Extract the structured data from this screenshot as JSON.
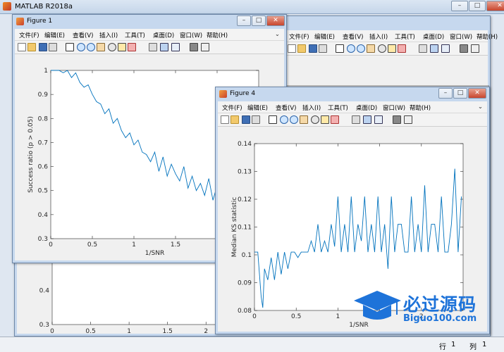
{
  "app": {
    "title": "MATLAB R2018a"
  },
  "statusbar": {
    "row_label": "行",
    "row_value": "1",
    "col_label": "列",
    "col_value": "1"
  },
  "menus": [
    "文件(F)",
    "编辑(E)",
    "查看(V)",
    "插入(I)",
    "工具(T)",
    "桌面(D)",
    "窗口(W)",
    "帮助(H)"
  ],
  "figure1": {
    "title": "Figure 1"
  },
  "figure4": {
    "title": "Figure 4"
  },
  "watermark": {
    "text": "必过源码",
    "subtext": "Biguo100.com"
  },
  "colors": {
    "line": "#0072bd",
    "window_chrome": "#c6d8ee",
    "figure_bg": "#f0f0f0"
  },
  "chart_data": [
    {
      "id": "figure1-axes",
      "type": "line",
      "xlabel": "1/SNR",
      "ylabel": "Success ratio (p > 0.05)",
      "xlim": [
        0,
        2.5
      ],
      "ylim": [
        0.3,
        1.0
      ],
      "xticks": [
        "0",
        "0.5",
        "1",
        "1.5",
        "2"
      ],
      "yticks": [
        "0.3",
        "0.4",
        "0.5",
        "0.6",
        "0.7",
        "0.8",
        "0.9",
        "1"
      ],
      "series": [
        {
          "x": [
            0.0,
            0.05,
            0.1,
            0.15,
            0.2,
            0.25,
            0.3,
            0.35,
            0.4,
            0.45,
            0.5,
            0.55,
            0.6,
            0.65,
            0.7,
            0.75,
            0.8,
            0.85,
            0.9,
            0.95,
            1.0,
            1.05,
            1.1,
            1.15,
            1.2,
            1.25,
            1.3,
            1.35,
            1.4,
            1.45,
            1.5,
            1.55,
            1.6,
            1.65,
            1.7,
            1.75,
            1.8,
            1.85,
            1.9,
            1.95,
            2.0,
            2.05,
            2.1,
            2.15,
            2.2,
            2.25,
            2.3,
            2.35,
            2.4
          ],
          "y": [
            1.0,
            1.0,
            1.0,
            0.99,
            1.0,
            0.97,
            0.99,
            0.95,
            0.93,
            0.94,
            0.9,
            0.87,
            0.86,
            0.82,
            0.84,
            0.78,
            0.8,
            0.75,
            0.72,
            0.74,
            0.69,
            0.71,
            0.66,
            0.65,
            0.62,
            0.66,
            0.58,
            0.64,
            0.56,
            0.61,
            0.57,
            0.54,
            0.6,
            0.51,
            0.56,
            0.5,
            0.53,
            0.48,
            0.55,
            0.46,
            0.52,
            0.44,
            0.5,
            0.42,
            0.47,
            0.4,
            0.51,
            0.45,
            0.58
          ]
        }
      ]
    },
    {
      "id": "figure4-axes",
      "type": "line",
      "xlabel": "1/SNR",
      "ylabel": "Median KS statistic",
      "xlim": [
        0,
        2.5
      ],
      "ylim": [
        0.08,
        0.14
      ],
      "xticks": [
        "0",
        "0.5",
        "1",
        "1.5",
        "2"
      ],
      "yticks": [
        "0.08",
        "0.09",
        "0.1",
        "0.11",
        "0.12",
        "0.13",
        "0.14"
      ],
      "series": [
        {
          "x": [
            0.0,
            0.04,
            0.08,
            0.1,
            0.12,
            0.16,
            0.2,
            0.24,
            0.28,
            0.32,
            0.36,
            0.4,
            0.44,
            0.48,
            0.52,
            0.56,
            0.6,
            0.64,
            0.68,
            0.72,
            0.76,
            0.8,
            0.84,
            0.88,
            0.92,
            0.96,
            1.0,
            1.04,
            1.08,
            1.12,
            1.16,
            1.2,
            1.24,
            1.28,
            1.32,
            1.36,
            1.4,
            1.44,
            1.48,
            1.52,
            1.56,
            1.6,
            1.64,
            1.68,
            1.72,
            1.76,
            1.8,
            1.84,
            1.88,
            1.92,
            1.96,
            2.0,
            2.04,
            2.08,
            2.12,
            2.16,
            2.2,
            2.24,
            2.28,
            2.32,
            2.36,
            2.4,
            2.44,
            2.48
          ],
          "y": [
            0.101,
            0.101,
            0.085,
            0.081,
            0.095,
            0.091,
            0.099,
            0.091,
            0.101,
            0.093,
            0.101,
            0.095,
            0.101,
            0.101,
            0.099,
            0.101,
            0.101,
            0.101,
            0.105,
            0.101,
            0.111,
            0.101,
            0.105,
            0.101,
            0.111,
            0.103,
            0.121,
            0.101,
            0.111,
            0.101,
            0.121,
            0.101,
            0.111,
            0.105,
            0.121,
            0.101,
            0.111,
            0.101,
            0.121,
            0.101,
            0.111,
            0.095,
            0.121,
            0.101,
            0.111,
            0.111,
            0.101,
            0.101,
            0.121,
            0.101,
            0.111,
            0.101,
            0.125,
            0.101,
            0.111,
            0.111,
            0.101,
            0.121,
            0.101,
            0.101,
            0.111,
            0.131,
            0.101,
            0.121
          ]
        }
      ]
    }
  ]
}
